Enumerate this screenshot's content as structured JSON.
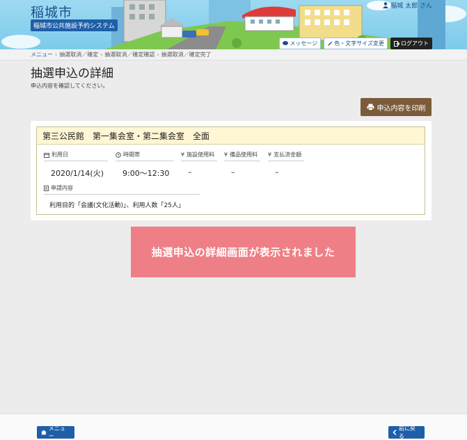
{
  "header": {
    "city_name": "稲城市",
    "system_name": "稲城市公共施設予約システム",
    "user_name": "稲城 太郎 さん",
    "buttons": {
      "message": "メッセージ",
      "color_size": "色・文字サイズ変更",
      "logout": "ログアウト"
    }
  },
  "breadcrumb": {
    "items": [
      "メニュー",
      "抽選取消／確定",
      "抽選取消／確定確認",
      "抽選取消／確定完了"
    ],
    "separator": "›"
  },
  "page": {
    "title": "抽選申込の詳細",
    "subtitle": "申込内容を確認してください。"
  },
  "print_button": {
    "label": "申込内容を印刷"
  },
  "facility": {
    "name": "第三公民館　第一集会室・第二集会室　全面",
    "fields": {
      "date": {
        "label": "利用日",
        "value": "2020/1/14(火)"
      },
      "time": {
        "label": "時間帯",
        "value": "9:00〜12:30"
      },
      "facility_fee": {
        "label": "施設使用料",
        "value": "–"
      },
      "equipment_fee": {
        "label": "備品使用料",
        "value": "–"
      },
      "paid_amount": {
        "label": "支払済金額",
        "value": "–"
      },
      "application": {
        "label": "申請内容",
        "value": "利用目的「会議(文化活動)」、利用人数「25人」"
      }
    }
  },
  "toast": {
    "message": "抽選申込の詳細画面が表示されました"
  },
  "footer": {
    "menu_label": "メニュー",
    "back_label": "前に戻る"
  },
  "colors": {
    "accent_blue": "#1f5fa8",
    "print_brown": "#7a5b3a",
    "toast_pink": "#ef7f86",
    "facility_header": "#fff6d4"
  },
  "icons": [
    "user-icon",
    "message-icon",
    "pen-icon",
    "logout-icon",
    "print-icon",
    "calendar-icon",
    "clock-icon",
    "yen-icon",
    "document-icon",
    "home-icon",
    "chevron-left-icon"
  ]
}
